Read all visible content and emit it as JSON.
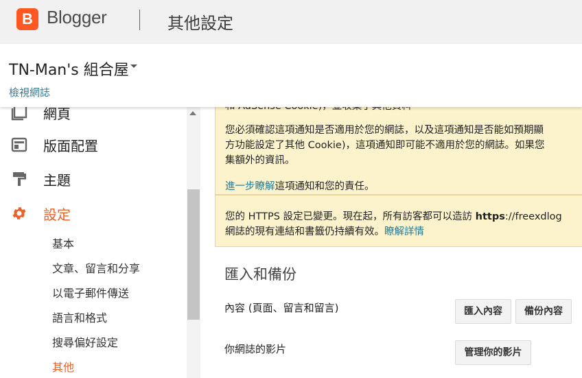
{
  "app": {
    "name": "Blogger",
    "page_title": "其他設定"
  },
  "blog": {
    "name": "TN-Man's 組合屋",
    "view_link": "檢視網誌"
  },
  "sidebar": {
    "items": [
      {
        "label": "網頁",
        "icon": "pages-icon"
      },
      {
        "label": "版面配置",
        "icon": "layout-icon"
      },
      {
        "label": "主題",
        "icon": "theme-icon"
      },
      {
        "label": "設定",
        "icon": "gear-icon",
        "active": true
      }
    ],
    "sub_items": [
      {
        "label": "基本"
      },
      {
        "label": "文章、留言和分享"
      },
      {
        "label": "以電子郵件傳送"
      },
      {
        "label": "語言和格式"
      },
      {
        "label": "搜尋偏好設定"
      },
      {
        "label": "其他",
        "active": true
      }
    ]
  },
  "notice": {
    "line0": "和 AdSense Cookie)，並收集了其他資料",
    "line1": "您必須確認這項通知是否適用於您的網誌，以及這項通知是否能如預期顯",
    "line2": "方功能設定了其他 Cookie)，這項通知即可能不適用於您的網誌。如果您",
    "line3": "集額外的資訊。",
    "learn_link": "進一步瞭解",
    "learn_rest": "這項通知和您的責任。"
  },
  "https_notice": {
    "line1_pre": "您的 HTTPS 設定已變更。現在起，所有訪客都可以造訪 ",
    "line1_bold": "https",
    "line1_post": "://freexdlog",
    "line2_pre": "網誌的現有連結和書籤仍持續有效。",
    "details_link": "瞭解詳情"
  },
  "import_backup": {
    "title": "匯入和備份",
    "content_label": "內容 (頁面、留言和留言)",
    "import_button": "匯入內容",
    "backup_button": "備份內容",
    "videos_label": "你網誌的影片",
    "manage_videos_button": "管理你的影片"
  },
  "colors": {
    "brand": "#ff5722",
    "active": "#e8632c",
    "link": "#2b7a8f",
    "notice_bg": "#fcf3cd"
  }
}
